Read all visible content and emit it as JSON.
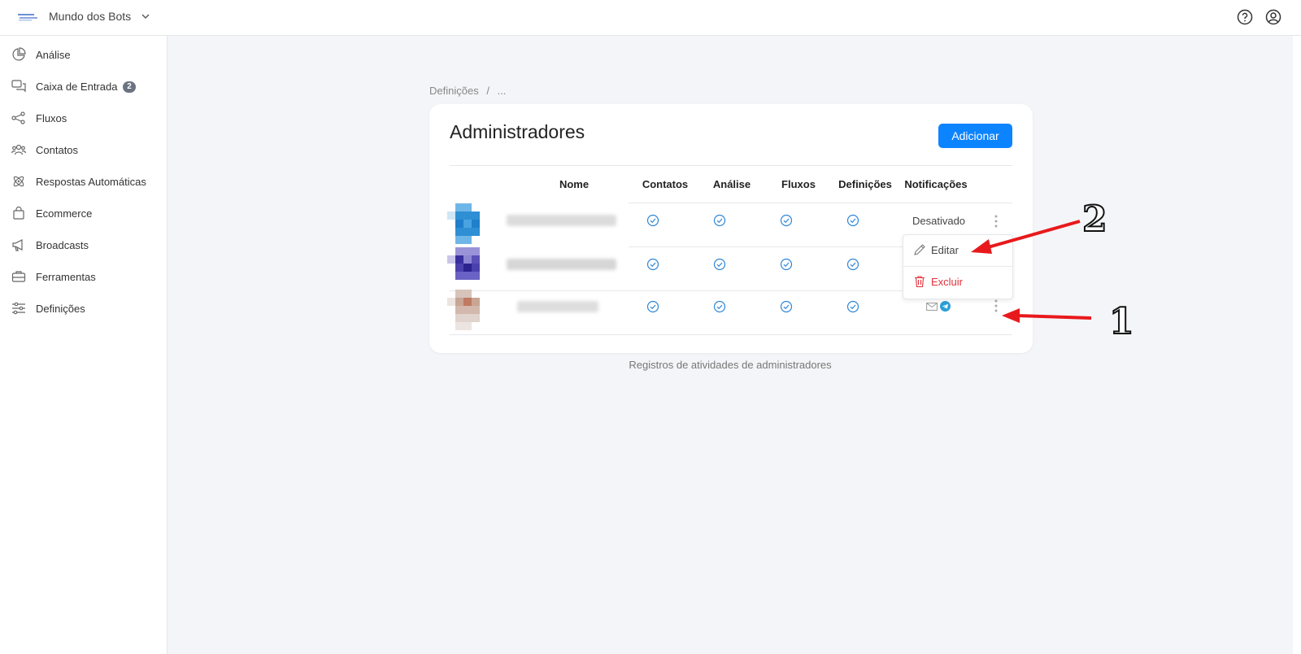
{
  "header": {
    "workspace": "Mundo dos Bots",
    "icons": [
      "help-icon",
      "account-icon"
    ]
  },
  "sidebar": {
    "items": [
      {
        "label": "Análise",
        "icon": "chart-pie-icon"
      },
      {
        "label": "Caixa de Entrada",
        "icon": "chat-bubbles-icon",
        "badge": "2"
      },
      {
        "label": "Fluxos",
        "icon": "flow-icon"
      },
      {
        "label": "Contatos",
        "icon": "users-icon"
      },
      {
        "label": "Respostas Automáticas",
        "icon": "atom-icon"
      },
      {
        "label": "Ecommerce",
        "icon": "shopping-bag-icon"
      },
      {
        "label": "Broadcasts",
        "icon": "megaphone-icon"
      },
      {
        "label": "Ferramentas",
        "icon": "toolbox-icon"
      },
      {
        "label": "Definições",
        "icon": "sliders-icon"
      }
    ]
  },
  "breadcrumb": {
    "root": "Definições",
    "sep": "/",
    "current": "..."
  },
  "card": {
    "title": "Administradores",
    "add_button": "Adicionar",
    "columns": [
      "Nome",
      "Contatos",
      "Análise",
      "Fluxos",
      "Definições",
      "Notificações"
    ],
    "rows": [
      {
        "permissions": [
          true,
          true,
          true,
          true
        ],
        "notifications": "Desativado"
      },
      {
        "permissions": [
          true,
          true,
          true,
          true
        ],
        "notifications": ""
      },
      {
        "permissions": [
          true,
          true,
          true,
          true
        ],
        "notifications_icons": [
          "mail-icon",
          "telegram-icon"
        ]
      }
    ]
  },
  "row_menu": {
    "edit": "Editar",
    "delete": "Excluir"
  },
  "footer_link": "Registros de atividades de administradores",
  "annotations": {
    "one": "1",
    "two": "2"
  },
  "colors": {
    "primary": "#0d84ff",
    "danger": "#e0303a",
    "annotation_arrow": "#e8191c"
  }
}
